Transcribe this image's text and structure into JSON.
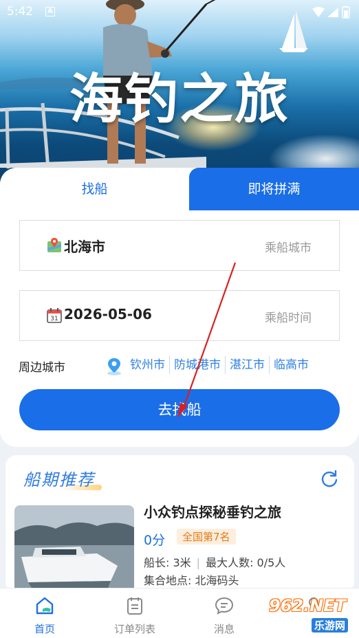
{
  "status_bar": {
    "time": "5:42",
    "notification_icon": "A"
  },
  "hero": {
    "title": "海钓之旅"
  },
  "tabs": [
    {
      "label": "找船",
      "active": true
    },
    {
      "label": "即将拼满",
      "active": false
    }
  ],
  "search": {
    "city_value": "北海市",
    "city_hint": "乘船城市",
    "date_value": "2026-05-06",
    "date_hint": "乘船时间",
    "date_icon_day": "31",
    "nearby_label": "周边城市",
    "nearby_cities": [
      "钦州市",
      "防城港市",
      "湛江市",
      "临高市"
    ],
    "submit_label": "去找船"
  },
  "recommend": {
    "title": "船期推荐",
    "item": {
      "title": "小众钓点探秘垂钓之旅",
      "score": "0分",
      "rank": "全国第7名",
      "length": "船长: 3米",
      "max_people": "最大人数: 0/5人",
      "meeting_point": "集合地点: 北海码头"
    }
  },
  "bottom_nav": [
    {
      "label": "首页",
      "icon": "home-icon",
      "active": true
    },
    {
      "label": "订单列表",
      "icon": "order-list-icon",
      "active": false
    },
    {
      "label": "消息",
      "icon": "message-icon",
      "active": false
    },
    {
      "label": "",
      "icon": "profile-icon",
      "active": false
    }
  ],
  "watermark": {
    "number": "962.NET",
    "site": "乐游网"
  },
  "colors": {
    "primary": "#1a6ee8",
    "link": "#2d7fe0",
    "rank_text": "#e07b1a",
    "rank_bg": "#fdeedd"
  }
}
